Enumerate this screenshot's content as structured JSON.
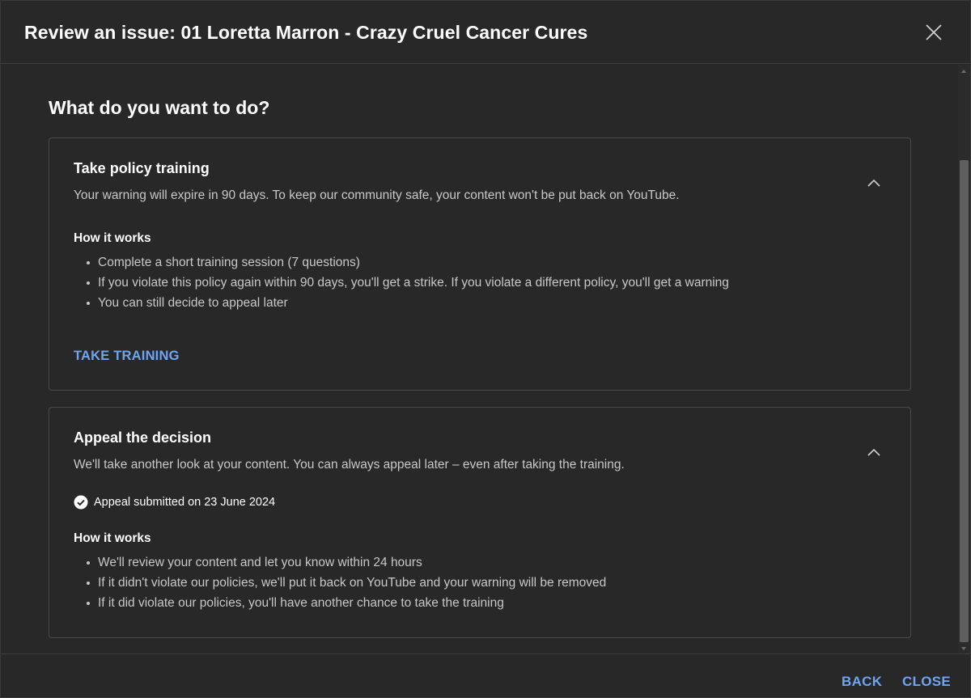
{
  "dialog": {
    "title": "Review an issue: 01 Loretta Marron - Crazy Cruel Cancer Cures",
    "close_icon": "close-icon",
    "question": "What do you want to do?"
  },
  "training_card": {
    "title": "Take policy training",
    "description": "Your warning will expire in 90 days. To keep our community safe, your content won't be put back on YouTube.",
    "how_title": "How it works",
    "bullets": [
      "Complete a short training session (7 questions)",
      "If you violate this policy again within 90 days, you'll get a strike. If you violate a different policy, you'll get a warning",
      "You can still decide to appeal later"
    ],
    "action_label": "TAKE TRAINING",
    "toggle_icon": "chevron-up-icon"
  },
  "appeal_card": {
    "title": "Appeal the decision",
    "description": "We'll take another look at your content. You can always appeal later – even after taking the training.",
    "status_icon": "check-circle-icon",
    "status_text": "Appeal submitted on 23 June 2024",
    "how_title": "How it works",
    "bullets": [
      "We'll review your content and let you know within 24 hours",
      "If it didn't violate our policies, we'll put it back on YouTube and your warning will be removed",
      "If it did violate our policies, you'll have another chance to take the training"
    ],
    "toggle_icon": "chevron-up-icon"
  },
  "footer": {
    "back_label": "BACK",
    "close_label": "CLOSE"
  },
  "colors": {
    "background": "#282828",
    "accent": "#6ea5f3",
    "text_primary": "#ffffff",
    "text_secondary": "#c8c8c8",
    "border": "#4a4a4a"
  }
}
